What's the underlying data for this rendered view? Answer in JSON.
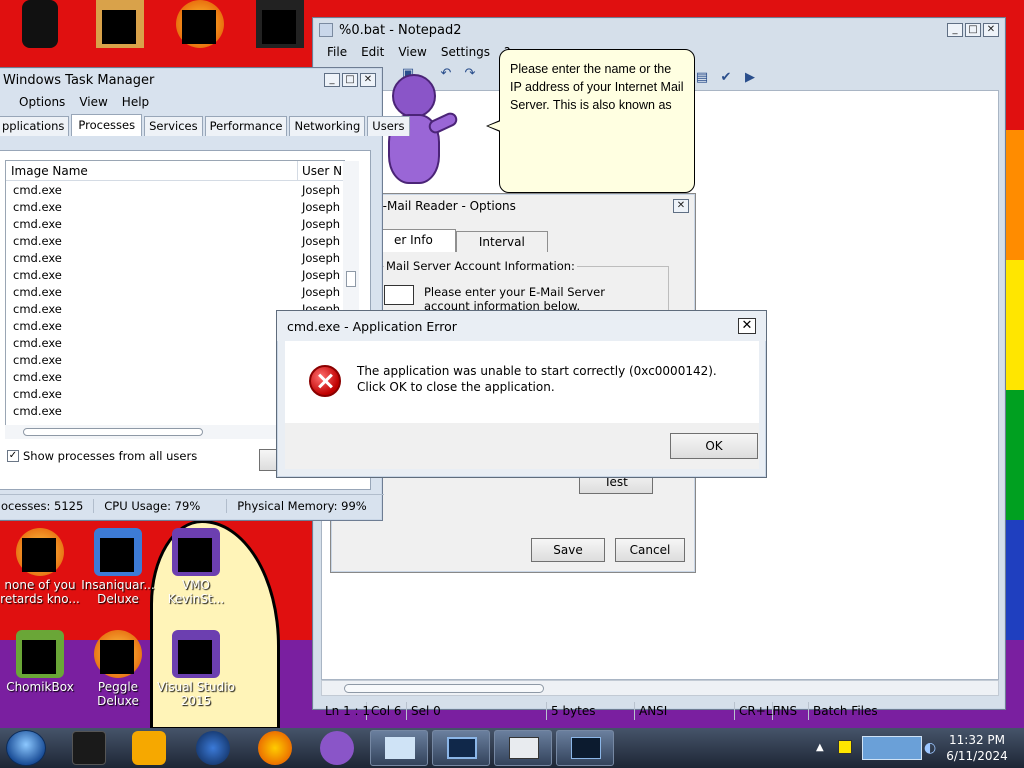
{
  "desktop": {
    "icons": [
      {
        "label": "none of you retards kno..."
      },
      {
        "label": "Insaniquar... Deluxe"
      },
      {
        "label": "VMO KevinSt..."
      },
      {
        "label": "ChomikBox"
      },
      {
        "label": "Peggle Deluxe"
      },
      {
        "label": "Visual Studio 2015"
      }
    ]
  },
  "notepad": {
    "title": "%0.bat - Notepad2",
    "menu": [
      "File",
      "Edit",
      "View",
      "Settings",
      "?"
    ],
    "status": {
      "position": "Ln 1 : 1",
      "col": "Col 6",
      "sel": "Sel 0",
      "size": "5 bytes",
      "encoding": "ANSI",
      "eol": "CR+LF",
      "mode": "INS",
      "lexer": "Batch Files"
    }
  },
  "bonzi": {
    "bubble_text": "Please enter the name or the IP address of your Internet Mail Server. This is also known as"
  },
  "email_options": {
    "title": "s E-Mail Reader - Options",
    "tabs": [
      "er Info",
      "Interval"
    ],
    "group_label": "Mail Server Account Information:",
    "instruction": "Please enter your E-Mail Server account information below.",
    "test_label": "Test",
    "save_label": "Save",
    "cancel_label": "Cancel"
  },
  "taskmgr": {
    "title": "Windows Task Manager",
    "menu": [
      "Options",
      "View",
      "Help"
    ],
    "tabs": [
      "pplications",
      "Processes",
      "Services",
      "Performance",
      "Networking",
      "Users"
    ],
    "active_tab": "Processes",
    "columns": [
      "Image Name",
      "User N"
    ],
    "rows": [
      {
        "name": "cmd.exe",
        "user": "Joseph"
      },
      {
        "name": "cmd.exe",
        "user": "Joseph"
      },
      {
        "name": "cmd.exe",
        "user": "Joseph"
      },
      {
        "name": "cmd.exe",
        "user": "Joseph"
      },
      {
        "name": "cmd.exe",
        "user": "Joseph"
      },
      {
        "name": "cmd.exe",
        "user": "Joseph"
      },
      {
        "name": "cmd.exe",
        "user": "Joseph"
      },
      {
        "name": "cmd.exe",
        "user": "Joseph"
      },
      {
        "name": "cmd.exe",
        "user": ""
      },
      {
        "name": "cmd.exe",
        "user": ""
      },
      {
        "name": "cmd.exe",
        "user": ""
      },
      {
        "name": "cmd.exe",
        "user": ""
      },
      {
        "name": "cmd.exe",
        "user": ""
      },
      {
        "name": "cmd.exe",
        "user": ""
      }
    ],
    "show_all_label": "Show processes from all users",
    "status": {
      "processes": "ocesses: 5125",
      "cpu": "CPU Usage: 79%",
      "memory": "Physical Memory: 99%"
    }
  },
  "error_dialog": {
    "title": "cmd.exe - Application Error",
    "message": "The application was unable to start correctly (0xc0000142). Click OK to close the application.",
    "ok_label": "OK",
    "close_glyph": "✕"
  },
  "taskbar": {
    "time": "11:32 PM",
    "date": "6/11/2024"
  }
}
